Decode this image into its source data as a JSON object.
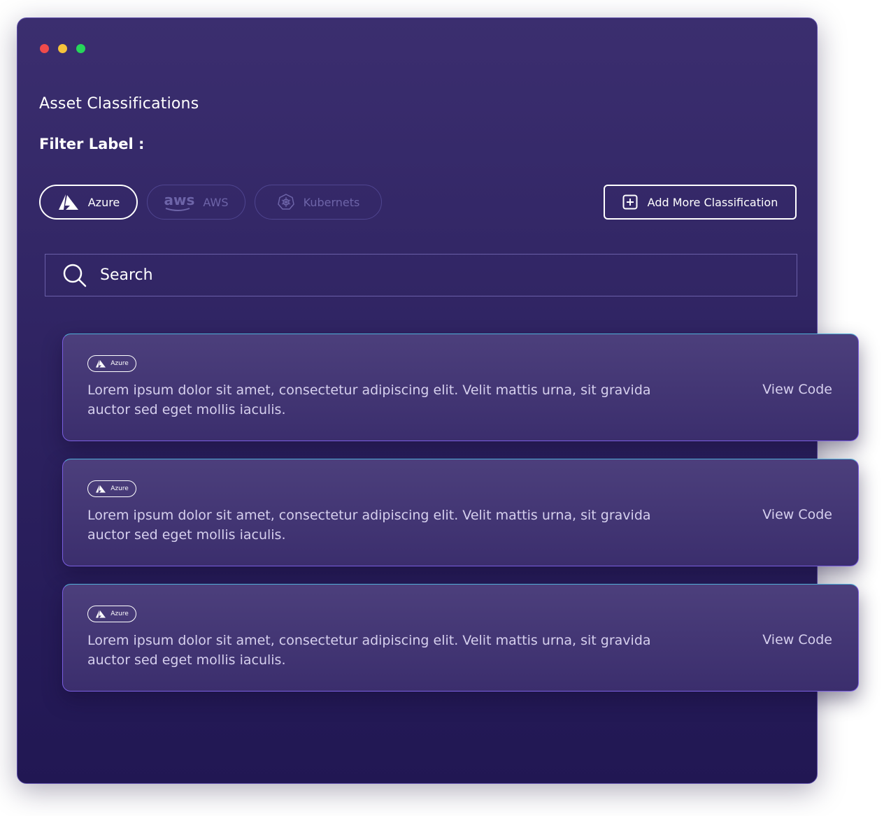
{
  "window": {
    "controls": [
      "close",
      "minimize",
      "maximize"
    ]
  },
  "page": {
    "title": "Asset Classifications",
    "filter_label": "Filter Label :"
  },
  "filters": [
    {
      "label": "Azure",
      "icon": "azure-icon",
      "active": true
    },
    {
      "label": "AWS",
      "icon": "aws-icon",
      "logo_text": "aws",
      "active": false
    },
    {
      "label": "Kubernets",
      "icon": "kubernetes-icon",
      "active": false
    }
  ],
  "actions": {
    "add_label": "Add More Classification",
    "add_icon": "plus-square-icon"
  },
  "search": {
    "placeholder": "Search",
    "icon": "search-icon"
  },
  "results": [
    {
      "badge": "Azure",
      "text": "Lorem ipsum dolor sit amet, consectetur adipiscing elit. Velit mattis urna, sit gravida auctor sed eget mollis iaculis.",
      "link": "View Code"
    },
    {
      "badge": "Azure",
      "text": "Lorem ipsum dolor sit amet, consectetur adipiscing elit. Velit mattis urna, sit gravida auctor sed eget mollis iaculis.",
      "link": "View Code"
    },
    {
      "badge": "Azure",
      "text": "Lorem ipsum dolor sit amet, consectetur adipiscing elit. Velit mattis urna, sit gravida auctor sed eget mollis iaculis.",
      "link": "View Code"
    }
  ],
  "colors": {
    "background_top": "#3b2e6f",
    "background_bottom": "#211753",
    "card": "#4c3f7c",
    "accent_border": "#7a5ee0"
  }
}
